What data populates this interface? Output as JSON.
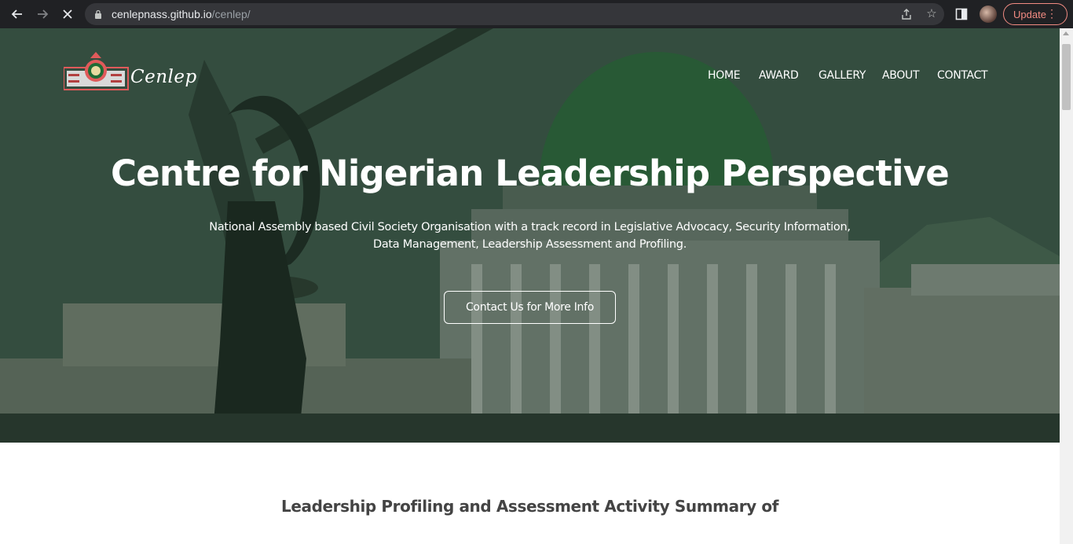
{
  "browser": {
    "url_host": "cenlepnass.github.io",
    "url_path": "/cenlep/",
    "update_label": "Update"
  },
  "site": {
    "logo_text": "Cenlep",
    "nav": [
      "HOME",
      "AWARD",
      "GALLERY",
      "ABOUT",
      "CONTACT"
    ]
  },
  "hero": {
    "title": "Centre for Nigerian Leadership Perspective",
    "subtitle": "National Assembly based Civil Society Organisation with a track record in Legislative Advocacy, Security Information, Data Management, Leadership Assessment and Profiling.",
    "cta_label": "Contact Us for More Info"
  },
  "summary": {
    "heading": "Leadership Profiling and Assessment Activity Summary of"
  },
  "colors": {
    "hero_green": "#3d5a49",
    "accent_green": "#1a6b2c",
    "update_red": "#f28b82"
  }
}
